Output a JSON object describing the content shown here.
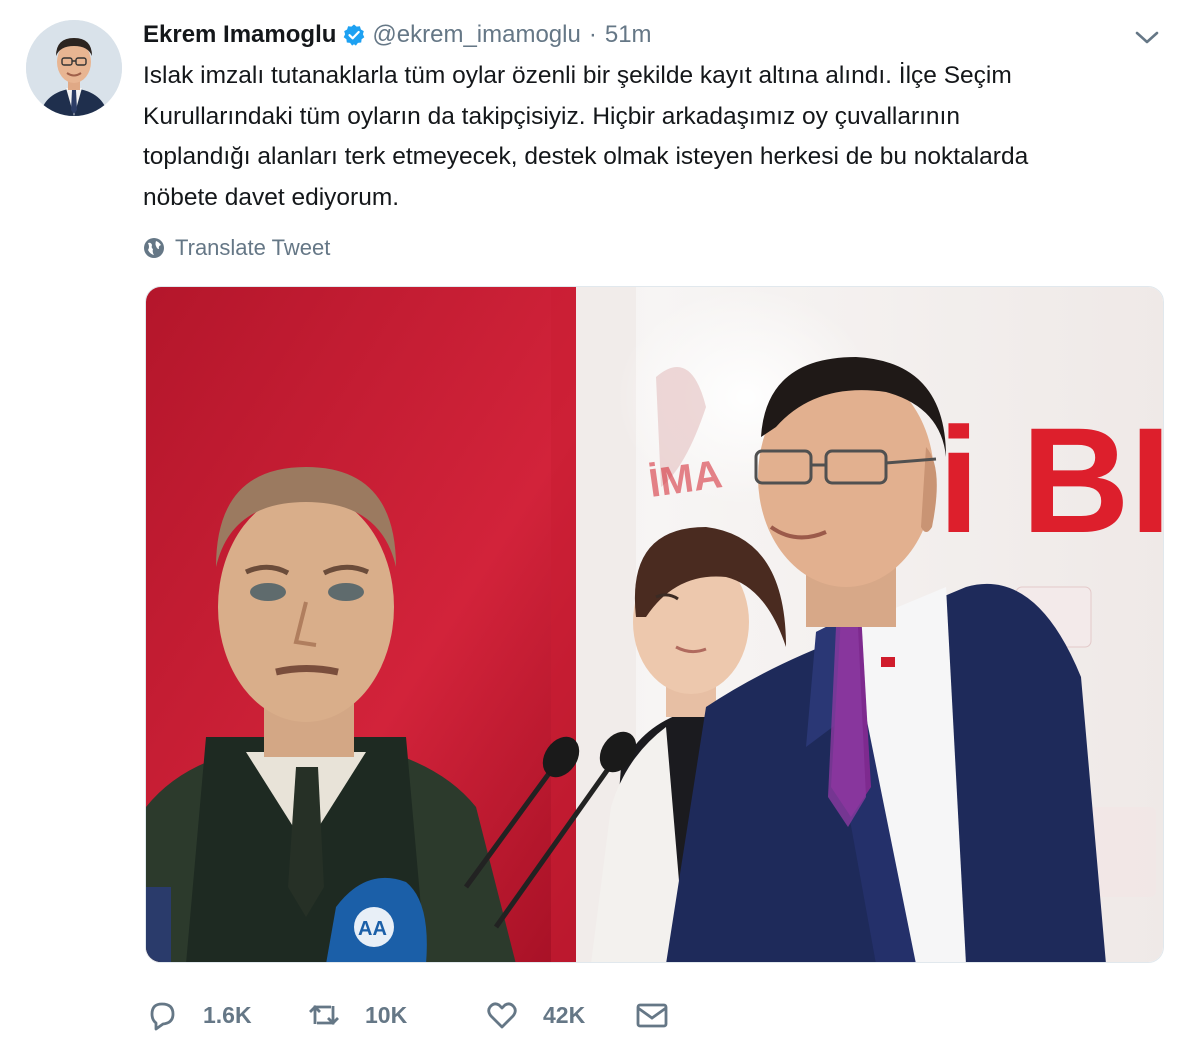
{
  "tweet": {
    "author_name": "Ekrem Imamoglu",
    "handle": "@ekrem_imamoglu",
    "separator": "·",
    "time": "51m",
    "text_lines": [
      "Islak imzalı tutanaklarla tüm oylar özenli bir şekilde kayıt altına alındı. İlçe Seçim",
      "Kurullarındaki tüm oyların da takipçisiyiz. Hiçbir arkadaşımız oy çuvallarının",
      "toplandığı alanları terk etmeyecek, destek olmak isteyen herkesi de bu noktalarda",
      "nöbete davet ediyorum."
    ],
    "translate_label": "Translate Tweet",
    "media": {
      "banner_text": "i BIR",
      "mic_label": "AA"
    }
  },
  "actions": {
    "replies": "1.6K",
    "retweets": "10K",
    "likes": "42K"
  },
  "colors": {
    "text": "#14171a",
    "secondary": "#657786",
    "verified": "#1da1f2",
    "flag_red": "#c8102e"
  },
  "icons": {
    "verified": "verified-badge-icon",
    "caret": "chevron-down-icon",
    "translate": "globe-icon",
    "reply": "reply-icon",
    "retweet": "retweet-icon",
    "like": "heart-icon",
    "dm": "envelope-icon"
  }
}
